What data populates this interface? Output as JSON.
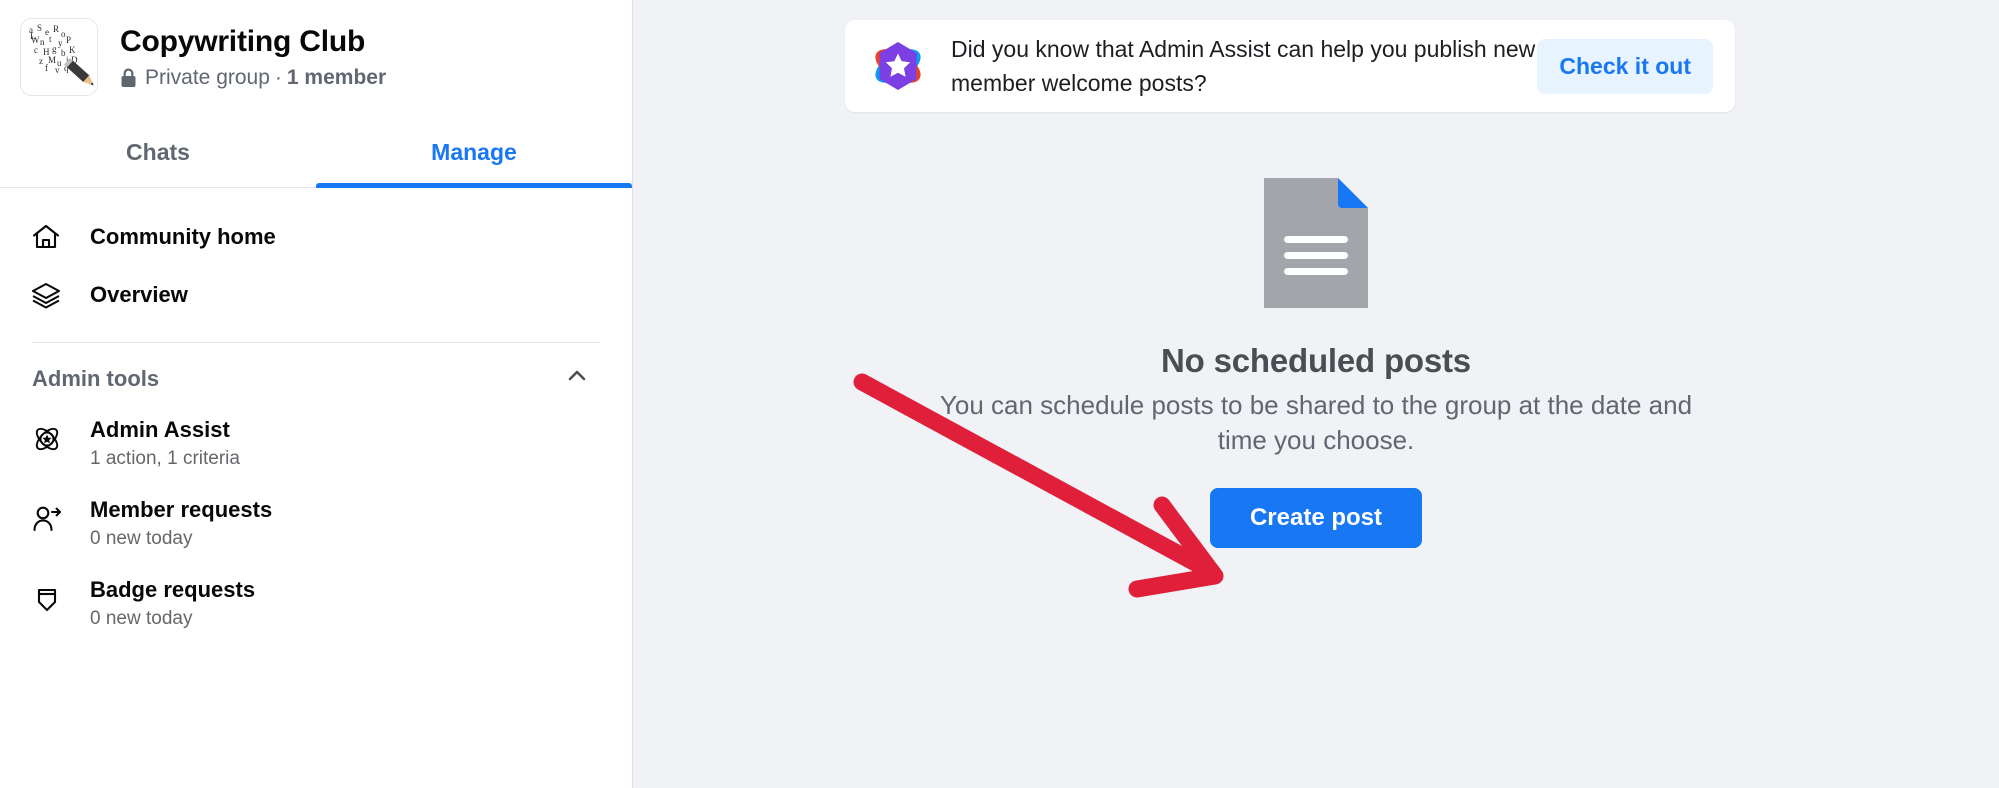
{
  "colors": {
    "accent_blue": "#1877f2",
    "banner_btn_bg": "#e7f3ff",
    "content_bg": "#f0f2f5",
    "sidebar_bg": "#ffffff",
    "annotation_red": "#e0203a",
    "doc_gray": "#a2a6ab",
    "text_primary": "#080809",
    "text_secondary": "#606770"
  },
  "sidebar": {
    "group": {
      "avatar_icon": "pencil-letters-avatar",
      "name": "Copywriting Club",
      "privacy_icon": "lock-icon",
      "privacy": "Private group",
      "separator": "·",
      "members": "1 member"
    },
    "tabs": [
      {
        "label": "Chats",
        "active": false
      },
      {
        "label": "Manage",
        "active": true
      }
    ],
    "nav": [
      {
        "label": "Community home",
        "icon": "home-icon"
      },
      {
        "label": "Overview",
        "icon": "layers-icon"
      }
    ],
    "admin_tools": {
      "title": "Admin tools",
      "collapse_icon": "chevron-up-icon",
      "items": [
        {
          "label": "Admin Assist",
          "sub": "1 action, 1 criteria",
          "icon": "admin-assist-icon"
        },
        {
          "label": "Member requests",
          "sub": "0 new today",
          "icon": "person-add-icon"
        },
        {
          "label": "Badge requests",
          "sub": "0 new today",
          "icon": "badge-icon"
        }
      ]
    }
  },
  "main": {
    "banner": {
      "icon": "admin-assist-star-icon",
      "text": "Did you know that Admin Assist can help you publish new member welcome posts?",
      "button_label": "Check it out"
    },
    "empty_state": {
      "icon": "document-icon",
      "title": "No scheduled posts",
      "description": "You can schedule posts to be shared to the group at the date and time you choose.",
      "button_label": "Create post"
    },
    "annotation": {
      "type": "red-arrow",
      "points_to": "Create post"
    }
  }
}
